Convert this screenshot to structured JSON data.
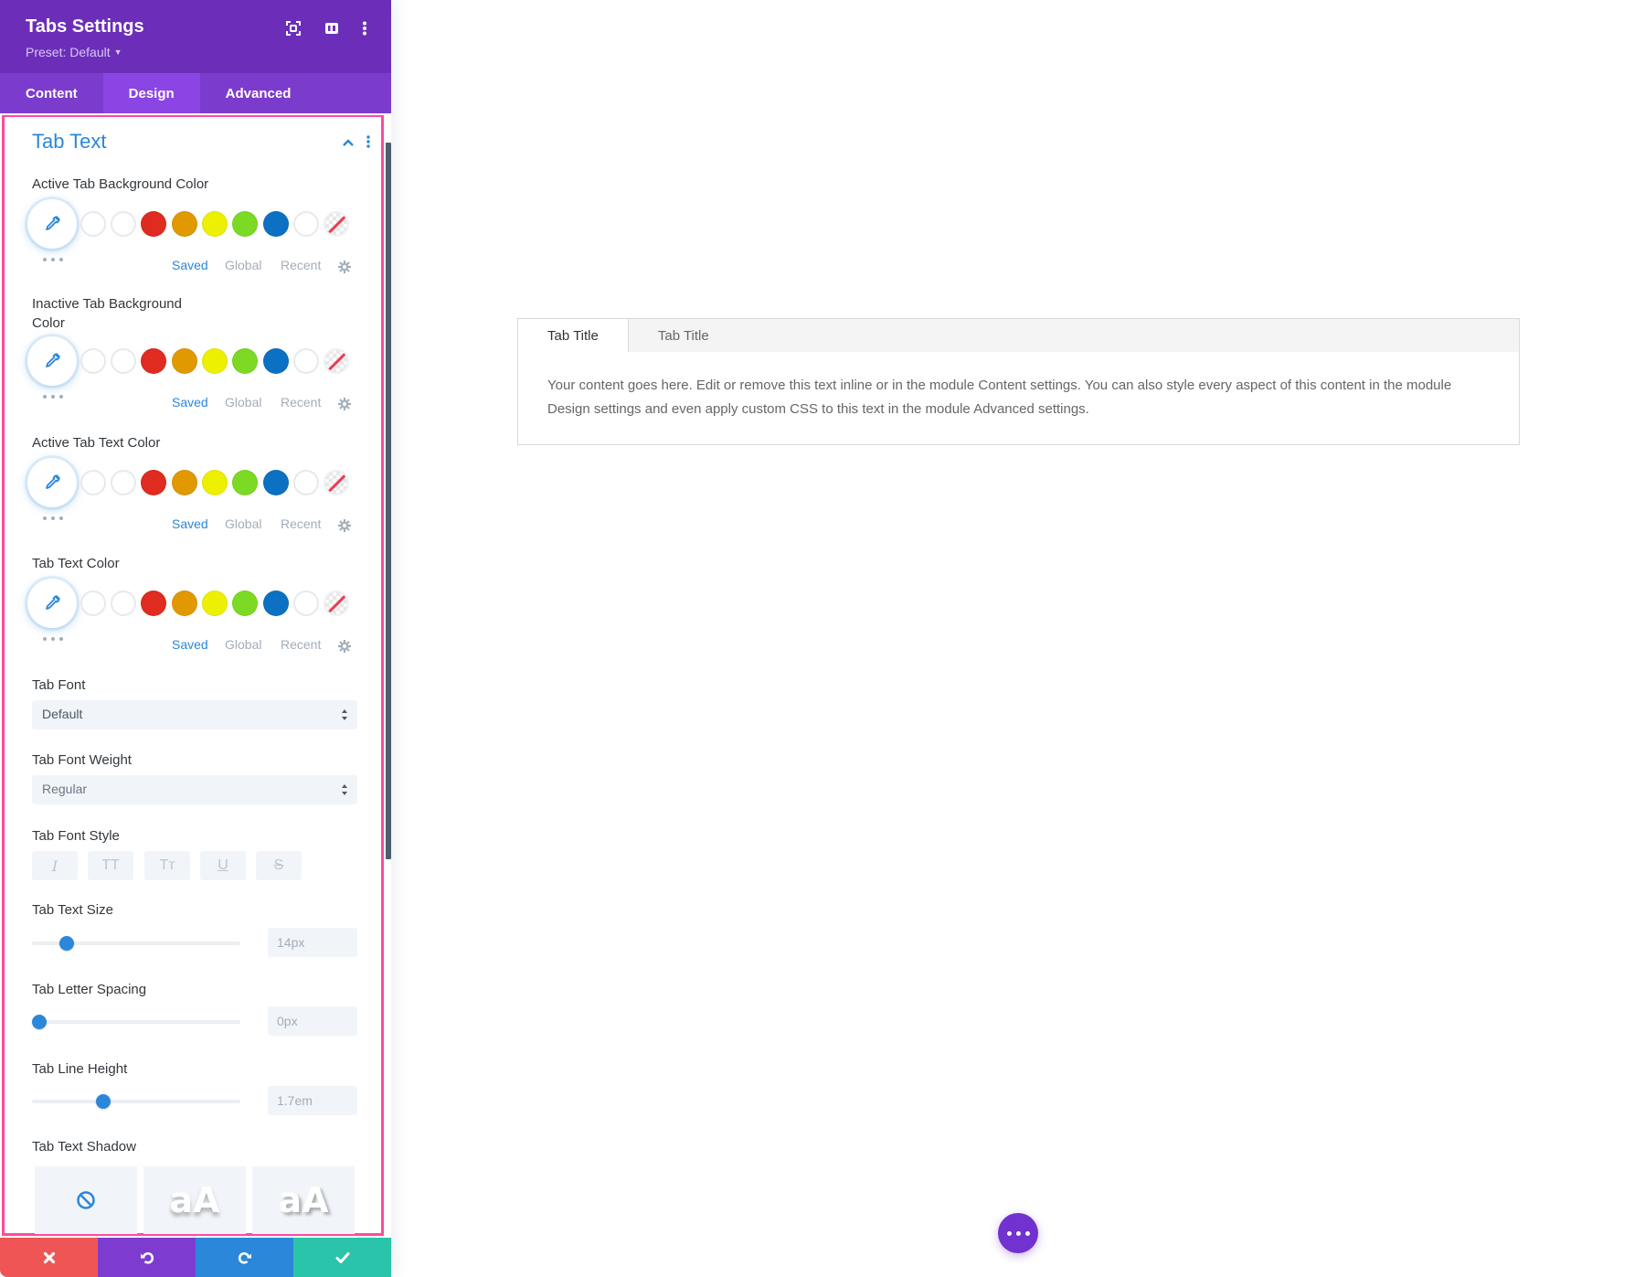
{
  "panel": {
    "title": "Tabs Settings",
    "preset": "Preset: Default",
    "header_icons": [
      "fullscreen-icon",
      "split-view-icon",
      "more-options-icon"
    ],
    "tabs": [
      {
        "label": "Content",
        "active": false
      },
      {
        "label": "Design",
        "active": true
      },
      {
        "label": "Advanced",
        "active": false
      }
    ],
    "section": {
      "title": "Tab Text",
      "expanded": true
    },
    "color_fields": [
      {
        "label": "Active Tab Background Color"
      },
      {
        "label": "Inactive Tab Background Color"
      },
      {
        "label": "Active Tab Text Color"
      },
      {
        "label": "Tab Text Color"
      }
    ],
    "swatches": [
      "#ffffff",
      "#ffffff",
      "#e02b20",
      "#e09900",
      "#edf000",
      "#7cda24",
      "#0c71c3",
      "#ffffff",
      "none"
    ],
    "picker_tabs": {
      "saved": "Saved",
      "global": "Global",
      "recent": "Recent",
      "active": "Saved"
    },
    "tab_font": {
      "label": "Tab Font",
      "value": "Default"
    },
    "tab_font_weight": {
      "label": "Tab Font Weight",
      "value": "Regular"
    },
    "tab_font_style": {
      "label": "Tab Font Style",
      "options": [
        {
          "name": "italic",
          "glyph": "I"
        },
        {
          "name": "uppercase",
          "glyph": "TT"
        },
        {
          "name": "capitalize",
          "glyph": "Tт"
        },
        {
          "name": "underline",
          "glyph": "U"
        },
        {
          "name": "strikethrough",
          "glyph": "S"
        }
      ]
    },
    "tab_text_size": {
      "label": "Tab Text Size",
      "value": "14px",
      "slider_fraction": 0.14
    },
    "tab_letter_spacing": {
      "label": "Tab Letter Spacing",
      "value": "0px",
      "slider_fraction": 0.0
    },
    "tab_line_height": {
      "label": "Tab Line Height",
      "value": "1.7em",
      "slider_fraction": 0.33
    },
    "tab_text_shadow": {
      "label": "Tab Text Shadow",
      "options": [
        "none",
        "aA",
        "aA"
      ]
    },
    "bottom_bar": [
      {
        "name": "discard",
        "color": "#ef5555"
      },
      {
        "name": "undo",
        "color": "#7e3bd0"
      },
      {
        "name": "redo",
        "color": "#2b87da"
      },
      {
        "name": "save",
        "color": "#29c4a9"
      }
    ]
  },
  "preview": {
    "tabs": [
      {
        "label": "Tab Title",
        "active": true
      },
      {
        "label": "Tab Title",
        "active": false
      }
    ],
    "content": "Your content goes here. Edit or remove this text inline or in the module Content settings. You can also style every aspect of this content in the module Design settings and even apply custom CSS to this text in the module Advanced settings."
  },
  "colors": {
    "header_purple": "#6c2eb9",
    "tabs_purple": "#7b3ccd",
    "active_tab_purple": "#8b45e5",
    "accent_blue": "#2b87da",
    "highlight_pink": "#ff4aa0",
    "fab_purple": "#7132cf"
  }
}
